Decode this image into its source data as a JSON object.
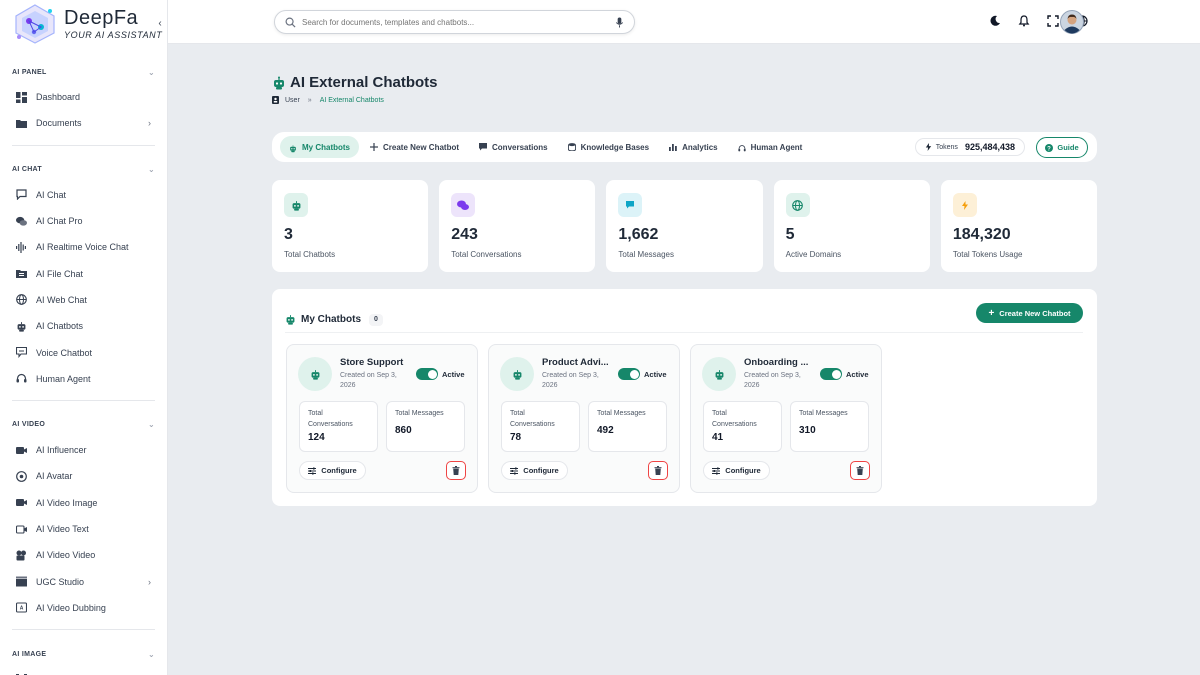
{
  "brand": {
    "name": "DeepFa",
    "tagline": "YOUR AI ASSISTANT",
    "accent": "#16876a"
  },
  "sidebar": {
    "sections": [
      {
        "title": "AI PANEL",
        "items": [
          {
            "label": "Dashboard",
            "icon": "dashboard-icon"
          },
          {
            "label": "Documents",
            "icon": "folder-icon",
            "has_arrow": true
          }
        ]
      },
      {
        "title": "AI CHAT",
        "items": [
          {
            "label": "AI Chat",
            "icon": "chat-icon"
          },
          {
            "label": "AI Chat Pro",
            "icon": "chats-icon"
          },
          {
            "label": "AI Realtime Voice Chat",
            "icon": "waveform-icon"
          },
          {
            "label": "AI File Chat",
            "icon": "file-folder-icon"
          },
          {
            "label": "AI Web Chat",
            "icon": "globe-icon"
          },
          {
            "label": "AI Chatbots",
            "icon": "robot-icon"
          },
          {
            "label": "Voice Chatbot",
            "icon": "voice-chat-icon"
          },
          {
            "label": "Human Agent",
            "icon": "headset-icon"
          }
        ]
      },
      {
        "title": "AI VIDEO",
        "items": [
          {
            "label": "AI Influencer",
            "icon": "influencer-icon"
          },
          {
            "label": "AI Avatar",
            "icon": "avatar-icon"
          },
          {
            "label": "AI Video Image",
            "icon": "video-image-icon"
          },
          {
            "label": "AI Video Text",
            "icon": "video-text-icon"
          },
          {
            "label": "AI Video Video",
            "icon": "video-video-icon"
          },
          {
            "label": "UGC Studio",
            "icon": "clapper-icon",
            "has_arrow": true
          },
          {
            "label": "AI Video Dubbing",
            "icon": "dubbing-icon"
          }
        ]
      },
      {
        "title": "AI IMAGE",
        "items": [
          {
            "label": "AI Images",
            "icon": "image-scan-icon"
          }
        ]
      }
    ]
  },
  "topbar": {
    "search_placeholder": "Search for documents, templates and chatbots..."
  },
  "page": {
    "title": "AI External Chatbots",
    "breadcrumb": {
      "root": "User",
      "sep": "»",
      "current": "AI External Chatbots"
    }
  },
  "tabs": [
    {
      "label": "My Chatbots",
      "icon": "robot-icon",
      "active": true
    },
    {
      "label": "Create New Chatbot",
      "icon": "plus-icon"
    },
    {
      "label": "Conversations",
      "icon": "message-icon"
    },
    {
      "label": "Knowledge Bases",
      "icon": "database-icon"
    },
    {
      "label": "Analytics",
      "icon": "bar-chart-icon"
    },
    {
      "label": "Human Agent",
      "icon": "headset-icon"
    }
  ],
  "tokens": {
    "label": "Tokens",
    "value": "925,484,438"
  },
  "guide_label": "Guide",
  "stats": [
    {
      "value": "3",
      "label": "Total Chatbots",
      "icon": "robot-icon",
      "bg": "#dff2ec",
      "fg": "#16876a"
    },
    {
      "value": "243",
      "label": "Total Conversations",
      "icon": "chats-icon",
      "bg": "#ede4fb",
      "fg": "#7c3aed"
    },
    {
      "value": "1,662",
      "label": "Total Messages",
      "icon": "message-icon",
      "bg": "#dcf3f8",
      "fg": "#0ea5c6"
    },
    {
      "value": "5",
      "label": "Active Domains",
      "icon": "globe-icon",
      "bg": "#dff2ec",
      "fg": "#16876a"
    },
    {
      "value": "184,320",
      "label": "Total Tokens Usage",
      "icon": "bolt-icon",
      "bg": "#fdf0d7",
      "fg": "#f59e0b"
    }
  ],
  "panel": {
    "title": "My Chatbots",
    "count": "0",
    "create_label": "Create New Chatbot"
  },
  "chatbots": [
    {
      "name": "Store Support",
      "created": "Created on Sep 3, 2026",
      "status": "Active",
      "conv_label": "Total Conversations",
      "conv": "124",
      "msg_label": "Total Messages",
      "msgs": "860",
      "configure": "Configure"
    },
    {
      "name": "Product Advi...",
      "created": "Created on Sep 3, 2026",
      "status": "Active",
      "conv_label": "Total Conversations",
      "conv": "78",
      "msg_label": "Total Messages",
      "msgs": "492",
      "configure": "Configure"
    },
    {
      "name": "Onboarding ...",
      "created": "Created on Sep 3, 2026",
      "status": "Active",
      "conv_label": "Total Conversations",
      "conv": "41",
      "msg_label": "Total Messages",
      "msgs": "310",
      "configure": "Configure"
    }
  ]
}
